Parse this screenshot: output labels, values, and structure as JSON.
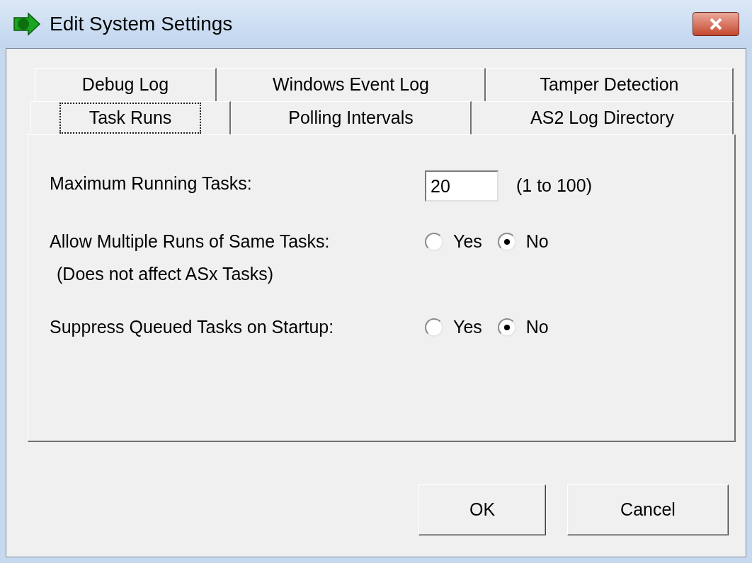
{
  "window": {
    "title": "Edit System Settings"
  },
  "tab_rows": [
    [
      {
        "label": "Debug Log",
        "selected": false
      },
      {
        "label": "Windows Event Log",
        "selected": false
      },
      {
        "label": "Tamper Detection",
        "selected": false
      }
    ],
    [
      {
        "label": "Task Runs",
        "selected": true
      },
      {
        "label": "Polling Intervals",
        "selected": false
      },
      {
        "label": "AS2 Log Directory",
        "selected": false
      }
    ]
  ],
  "settings": [
    {
      "kind": "number",
      "label": "Maximum Running Tasks:",
      "value": "20",
      "hint": "(1 to 100)"
    },
    {
      "kind": "radio",
      "label": "Allow Multiple Runs of Same Tasks:",
      "note": "(Does not affect ASx Tasks)",
      "options": [
        {
          "label": "Yes",
          "selected": false
        },
        {
          "label": "No",
          "selected": true
        }
      ]
    },
    {
      "kind": "radio",
      "label": "Suppress Queued Tasks on Startup:",
      "options": [
        {
          "label": "Yes",
          "selected": false
        },
        {
          "label": "No",
          "selected": true
        }
      ]
    }
  ],
  "buttons": [
    "OK",
    "Cancel"
  ]
}
